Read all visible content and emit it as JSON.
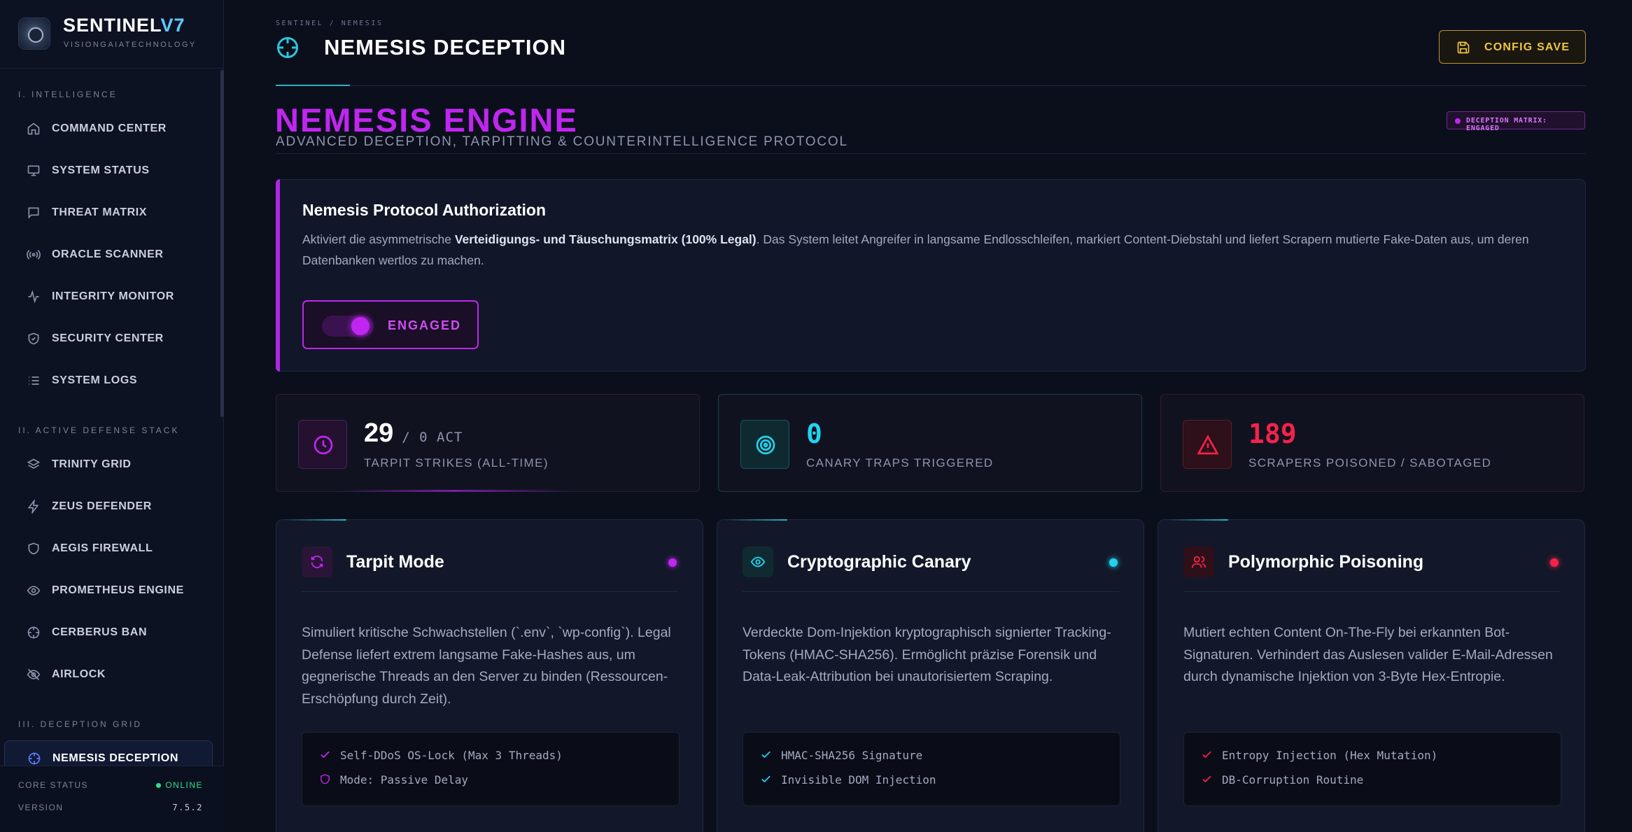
{
  "brand": {
    "name_main": "SENTINEL",
    "name_accent": "V7",
    "subtitle": "VISIONGAIATECHNOLOGY"
  },
  "sidebar": {
    "sections": [
      {
        "title": "I. INTELLIGENCE",
        "items": [
          {
            "label": "COMMAND CENTER",
            "icon": "home-icon"
          },
          {
            "label": "SYSTEM STATUS",
            "icon": "monitor-icon"
          },
          {
            "label": "THREAT MATRIX",
            "icon": "message-square-icon"
          },
          {
            "label": "ORACLE SCANNER",
            "icon": "radio-icon"
          },
          {
            "label": "INTEGRITY MONITOR",
            "icon": "activity-icon"
          },
          {
            "label": "SECURITY CENTER",
            "icon": "shield-check-icon"
          },
          {
            "label": "SYSTEM LOGS",
            "icon": "list-icon"
          }
        ]
      },
      {
        "title": "II. ACTIVE DEFENSE STACK",
        "items": [
          {
            "label": "TRINITY GRID",
            "icon": "layers-icon"
          },
          {
            "label": "ZEUS DEFENDER",
            "icon": "zap-icon"
          },
          {
            "label": "AEGIS FIREWALL",
            "icon": "shield-icon"
          },
          {
            "label": "PROMETHEUS ENGINE",
            "icon": "eye-icon"
          },
          {
            "label": "CERBERUS BAN",
            "icon": "crosshair-icon"
          },
          {
            "label": "AIRLOCK",
            "icon": "eye-off-icon"
          }
        ]
      },
      {
        "title": "III. DECEPTION GRID",
        "items": [
          {
            "label": "NEMESIS DECEPTION",
            "icon": "crosshair-icon",
            "active": true
          }
        ]
      }
    ],
    "core": {
      "status_label": "CORE STATUS",
      "status_value": "ONLINE",
      "version_label": "VERSION",
      "version_value": "7.5.2"
    }
  },
  "header": {
    "breadcrumb": "SENTINEL / NEMESIS",
    "title": "NEMESIS DECEPTION",
    "config_button": "CONFIG SAVE"
  },
  "engine": {
    "title": "NEMESIS ENGINE",
    "subtitle": "ADVANCED DECEPTION, TARPITTING & COUNTERINTELLIGENCE PROTOCOL",
    "badge": "DECEPTION MATRIX: ENGAGED"
  },
  "auth": {
    "title": "Nemesis Protocol Authorization",
    "text_before": "Aktiviert die asymmetrische ",
    "text_bold": "Verteidigungs- und Täuschungsmatrix (100% Legal)",
    "text_after": ". Das System leitet Angreifer in langsame Endlosschleifen, markiert Content-Diebstahl und liefert Scrapern mutierte Fake-Daten aus, um deren Datenbanken wertlos zu machen.",
    "toggle_label": "ENGAGED",
    "toggle_on": true
  },
  "stats": [
    {
      "value": "29",
      "unit": "/ 0 ACT",
      "label": "TARPIT STRIKES (ALL-TIME)",
      "icon": "clock-icon",
      "color": "#ffffff",
      "accent": "#c026f0"
    },
    {
      "value": "0",
      "unit": "",
      "label": "CANARY TRAPS TRIGGERED",
      "icon": "target-icon",
      "color": "#22d3ee",
      "accent": "#22d3ee"
    },
    {
      "value": "189",
      "unit": "",
      "label": "SCRAPERS POISONED / SABOTAGED",
      "icon": "alert-triangle-icon",
      "color": "#f5224a",
      "accent": "#f5224a"
    }
  ],
  "features": [
    {
      "title": "Tarpit Mode",
      "icon": "refresh-icon",
      "accent": "#c026f0",
      "description": "Simuliert kritische Schwachstellen (`.env`, `wp-config`). Legal Defense liefert extrem langsame Fake-Hashes aus, um gegnerische Threads an den Server zu binden (Ressourcen-Erschöpfung durch Zeit).",
      "items": [
        {
          "text": "Self-DDoS OS-Lock (Max 3 Threads)",
          "icon": "check-icon"
        },
        {
          "text": "Mode: Passive Delay",
          "icon": "shield-icon"
        }
      ]
    },
    {
      "title": "Cryptographic Canary",
      "icon": "eye-icon",
      "accent": "#22d3ee",
      "description": "Verdeckte Dom-Injektion kryptographisch signierter Tracking-Tokens (HMAC-SHA256). Ermöglicht präzise Forensik und Data-Leak-Attribution bei unautorisiertem Scraping.",
      "items": [
        {
          "text": "HMAC-SHA256 Signature",
          "icon": "check-icon"
        },
        {
          "text": "Invisible DOM Injection",
          "icon": "check-icon"
        }
      ]
    },
    {
      "title": "Polymorphic Poisoning",
      "icon": "users-icon",
      "accent": "#f5224a",
      "description": "Mutiert echten Content On-The-Fly bei erkannten Bot-Signaturen. Verhindert das Auslesen valider E-Mail-Adressen durch dynamische Injektion von 3-Byte Hex-Entropie.",
      "items": [
        {
          "text": "Entropy Injection (Hex Mutation)",
          "icon": "check-icon"
        },
        {
          "text": "DB-Corruption Routine",
          "icon": "check-icon"
        }
      ]
    }
  ]
}
